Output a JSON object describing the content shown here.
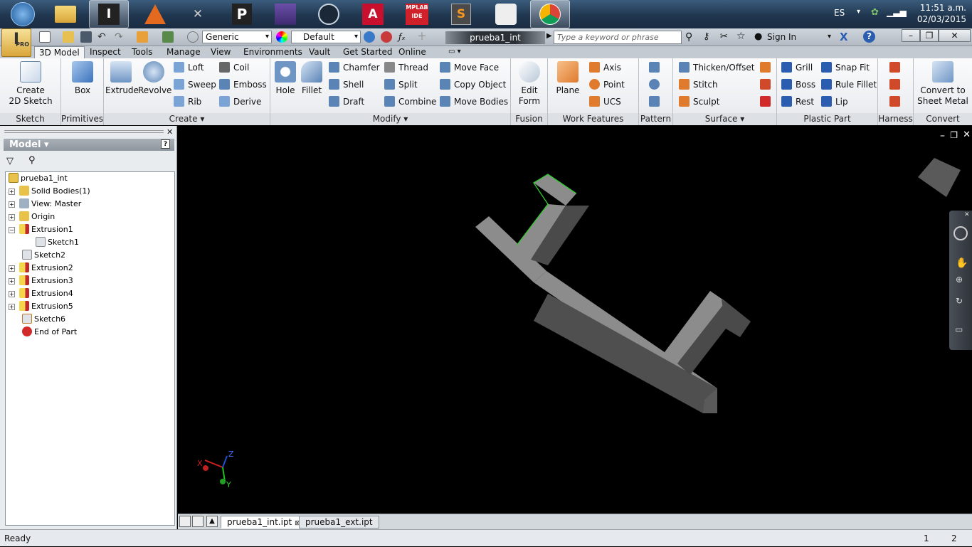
{
  "taskbar": {
    "apps": [
      {
        "name": "start-orb",
        "glyph": "⊞"
      },
      {
        "name": "file-explorer",
        "glyph": "▤"
      },
      {
        "name": "inventor-pro",
        "glyph": "I"
      },
      {
        "name": "matlab",
        "glyph": "▲"
      },
      {
        "name": "app-x",
        "glyph": "✕"
      },
      {
        "name": "app-p",
        "glyph": "P"
      },
      {
        "name": "app-stack",
        "glyph": "≡"
      },
      {
        "name": "steam",
        "glyph": "◉"
      },
      {
        "name": "autocad",
        "glyph": "A"
      },
      {
        "name": "mplab-ide",
        "glyph": "M"
      },
      {
        "name": "sublime",
        "glyph": "S"
      },
      {
        "name": "app-mouse",
        "glyph": "✎"
      },
      {
        "name": "chrome",
        "glyph": "◎"
      }
    ],
    "language": "ES",
    "time": "11:51 a.m.",
    "date": "02/03/2015"
  },
  "titlebar": {
    "material": "Generic",
    "appearance": "Default",
    "document_title": "prueba1_int",
    "search_placeholder": "Type a keyword or phrase",
    "sign_in": "Sign In",
    "app_badge": "PRO"
  },
  "tabs": [
    "3D Model",
    "Inspect",
    "Tools",
    "Manage",
    "View",
    "Environments",
    "Vault",
    "Get Started",
    "Online"
  ],
  "ribbon": {
    "sketch": {
      "label": "Sketch",
      "create": "Create\n2D Sketch"
    },
    "primitives": {
      "label": "Primitives",
      "box": "Box"
    },
    "create": {
      "label": "Create ▾",
      "extrude": "Extrude",
      "revolve": "Revolve",
      "loft": "Loft",
      "sweep": "Sweep",
      "rib": "Rib",
      "coil": "Coil",
      "emboss": "Emboss",
      "derive": "Derive"
    },
    "modify": {
      "label": "Modify ▾",
      "hole": "Hole",
      "fillet": "Fillet",
      "chamfer": "Chamfer",
      "shell": "Shell",
      "draft": "Draft",
      "thread": "Thread",
      "split": "Split",
      "combine": "Combine",
      "move_face": "Move Face",
      "copy_object": "Copy Object",
      "move_bodies": "Move Bodies"
    },
    "fusion": {
      "label": "Fusion",
      "edit_form": "Edit\nForm"
    },
    "work": {
      "label": "Work Features",
      "plane": "Plane",
      "axis": "Axis",
      "point": "Point",
      "ucs": "UCS"
    },
    "pattern": {
      "label": "Pattern"
    },
    "surface": {
      "label": "Surface ▾",
      "thicken": "Thicken/Offset",
      "stitch": "Stitch",
      "sculpt": "Sculpt"
    },
    "plastic": {
      "label": "Plastic Part",
      "grill": "Grill",
      "boss": "Boss",
      "rest": "Rest",
      "snap_fit": "Snap Fit",
      "rule_fillet": "Rule Fillet",
      "lip": "Lip"
    },
    "harness": {
      "label": "Harness"
    },
    "convert": {
      "label": "Convert",
      "to_sheet_metal": "Convert to\nSheet Metal"
    }
  },
  "panel": {
    "title": "Model ▾",
    "tree": [
      {
        "label": "prueba1_int",
        "icon": "part-icon"
      },
      {
        "label": "Solid Bodies(1)",
        "icon": "folder-icon"
      },
      {
        "label": "View: Master",
        "icon": "view-icon"
      },
      {
        "label": "Origin",
        "icon": "folder-icon"
      },
      {
        "label": "Extrusion1",
        "icon": "extrusion-icon"
      },
      {
        "label": "Sketch1",
        "icon": "sketch-icon"
      },
      {
        "label": "Sketch2",
        "icon": "sketch-icon"
      },
      {
        "label": "Extrusion2",
        "icon": "extrusion-icon"
      },
      {
        "label": "Extrusion3",
        "icon": "extrusion-icon"
      },
      {
        "label": "Extrusion4",
        "icon": "extrusion-icon"
      },
      {
        "label": "Extrusion5",
        "icon": "extrusion-icon"
      },
      {
        "label": "Sketch6",
        "icon": "sketch-icon"
      },
      {
        "label": "End of Part",
        "icon": "end-of-part-icon"
      }
    ]
  },
  "viewport": {
    "axis_x": "X",
    "axis_y": "Y",
    "axis_z": "Z",
    "colors": {
      "face_light": "#8c8c8c",
      "face_dark": "#4f4f4f",
      "edge_selected": "#2bd12b"
    }
  },
  "doc_tabs": [
    "prueba1_int.ipt",
    "prueba1_ext.ipt"
  ],
  "status": {
    "text": "Ready",
    "num1": "1",
    "num2": "2"
  }
}
